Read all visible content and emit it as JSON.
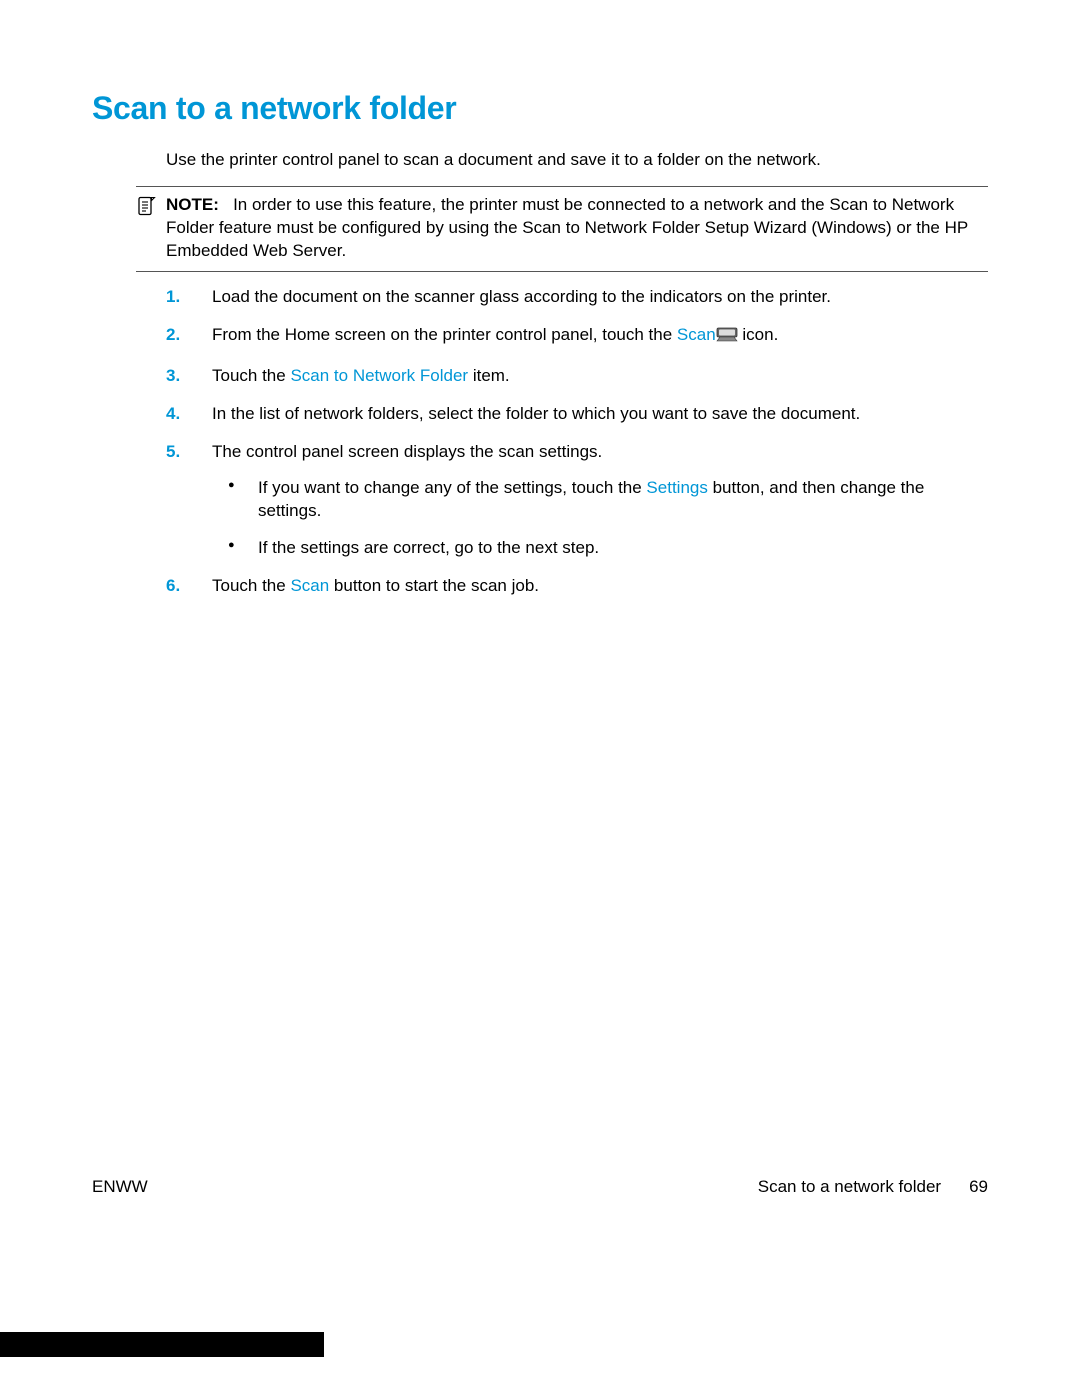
{
  "title": "Scan to a network folder",
  "intro": "Use the printer control panel to scan a document and save it to a folder on the network.",
  "note": {
    "label": "NOTE:",
    "body": "In order to use this feature, the printer must be connected to a network and the Scan to Network Folder feature must be configured by using the Scan to Network Folder Setup Wizard (Windows) or the HP Embedded Web Server."
  },
  "steps": [
    {
      "segments": [
        {
          "t": "Load the document on the scanner glass according to the indicators on the printer."
        }
      ]
    },
    {
      "segments": [
        {
          "t": "From the Home screen on the printer control panel, touch the "
        },
        {
          "t": "Scan",
          "hl": true
        },
        {
          "t": " ",
          "icon": "scanner-icon"
        },
        {
          "t": " icon."
        }
      ]
    },
    {
      "segments": [
        {
          "t": "Touch the "
        },
        {
          "t": "Scan to Network Folder",
          "hl": true
        },
        {
          "t": " item."
        }
      ]
    },
    {
      "segments": [
        {
          "t": "In the list of network folders, select the folder to which you want to save the document."
        }
      ]
    },
    {
      "segments": [
        {
          "t": "The control panel screen displays the scan settings."
        }
      ],
      "subs": [
        {
          "segments": [
            {
              "t": "If you want to change any of the settings, touch the "
            },
            {
              "t": "Settings",
              "hl": true
            },
            {
              "t": " button, and then change the settings."
            }
          ]
        },
        {
          "segments": [
            {
              "t": "If the settings are correct, go to the next step."
            }
          ]
        }
      ]
    },
    {
      "segments": [
        {
          "t": "Touch the "
        },
        {
          "t": "Scan",
          "hl": true
        },
        {
          "t": " button to start the scan job."
        }
      ]
    }
  ],
  "footer": {
    "left": "ENWW",
    "right_label": "Scan to a network folder",
    "page": "69"
  }
}
